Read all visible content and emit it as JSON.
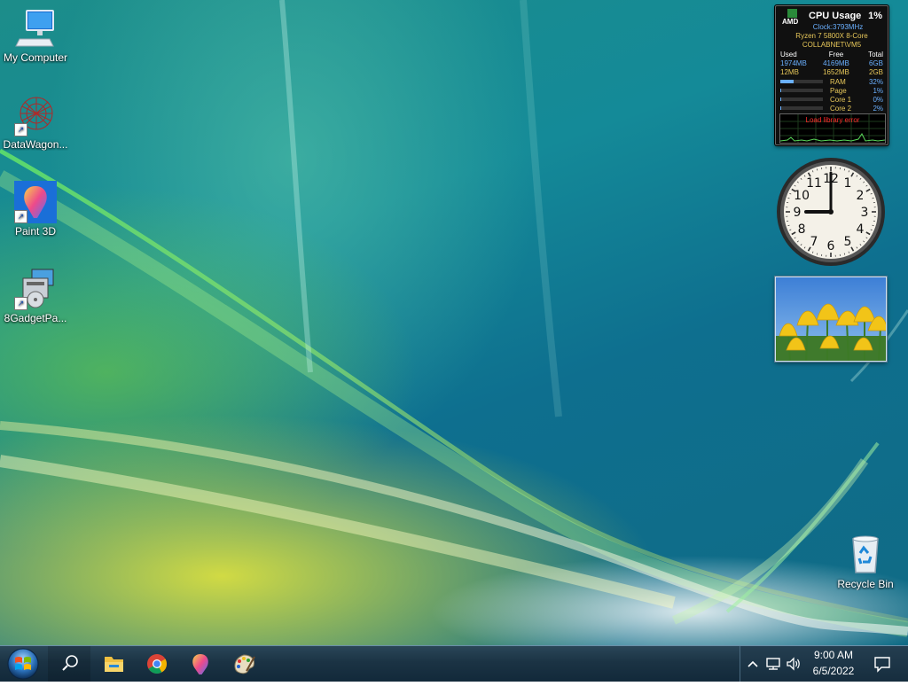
{
  "desktop": {
    "icons": [
      {
        "label": "My Computer",
        "icon": "computer-icon"
      },
      {
        "label": "DataWagon...",
        "icon": "datawagon-icon"
      },
      {
        "label": "Paint 3D",
        "icon": "paint3d-icon"
      },
      {
        "label": "8GadgetPa...",
        "icon": "installer-icon"
      },
      {
        "label": "Recycle Bin",
        "icon": "recycle-bin-icon"
      }
    ]
  },
  "cpu_gadget": {
    "brand": "AMD",
    "title": "CPU Usage",
    "total_percent": "1%",
    "clock": "Clock:3793MHz",
    "cpu_model": "Ryzen 7 5800X 8-Core",
    "host": "COLLABNET\\VM5",
    "memory_headers": [
      "Used",
      "Free",
      "Total"
    ],
    "memory_rows": [
      [
        "1974MB",
        "4169MB",
        "6GB"
      ],
      [
        "12MB",
        "1652MB",
        "2GB"
      ]
    ],
    "meters": [
      {
        "label": "RAM",
        "value": "32%",
        "fraction": 0.32
      },
      {
        "label": "Page",
        "value": "1%",
        "fraction": 0.01
      },
      {
        "label": "Core 1",
        "value": "0%",
        "fraction": 0.0
      },
      {
        "label": "Core 2",
        "value": "2%",
        "fraction": 0.02
      }
    ],
    "graph_error": "Load library error"
  },
  "clock_gadget": {
    "numerals": [
      "1",
      "2",
      "3",
      "4",
      "5",
      "6",
      "7",
      "8",
      "9",
      "10",
      "11",
      "12"
    ],
    "hour": 9,
    "minute": 0
  },
  "slideshow_gadget": {
    "subject": "yellow-tulips-photo"
  },
  "taskbar": {
    "start_icon": "windows-orb-icon",
    "search_icon": "search-icon",
    "pinned": [
      {
        "name": "File Explorer",
        "icon": "folder-icon"
      },
      {
        "name": "Google Chrome",
        "icon": "chrome-icon"
      },
      {
        "name": "Paint 3D",
        "icon": "paint3d-icon"
      },
      {
        "name": "Paint",
        "icon": "palette-icon"
      }
    ],
    "tray": {
      "time": "9:00 AM",
      "date": "6/5/2022",
      "icons": [
        "chevron-up-icon",
        "network-icon",
        "volume-icon",
        "notification-icon"
      ]
    }
  },
  "colors": {
    "taskbar": "#1b3344",
    "gadget_text": "#6ab0ff",
    "gadget_accent": "#e8c85a",
    "graph_error": "#ff2a2a"
  }
}
